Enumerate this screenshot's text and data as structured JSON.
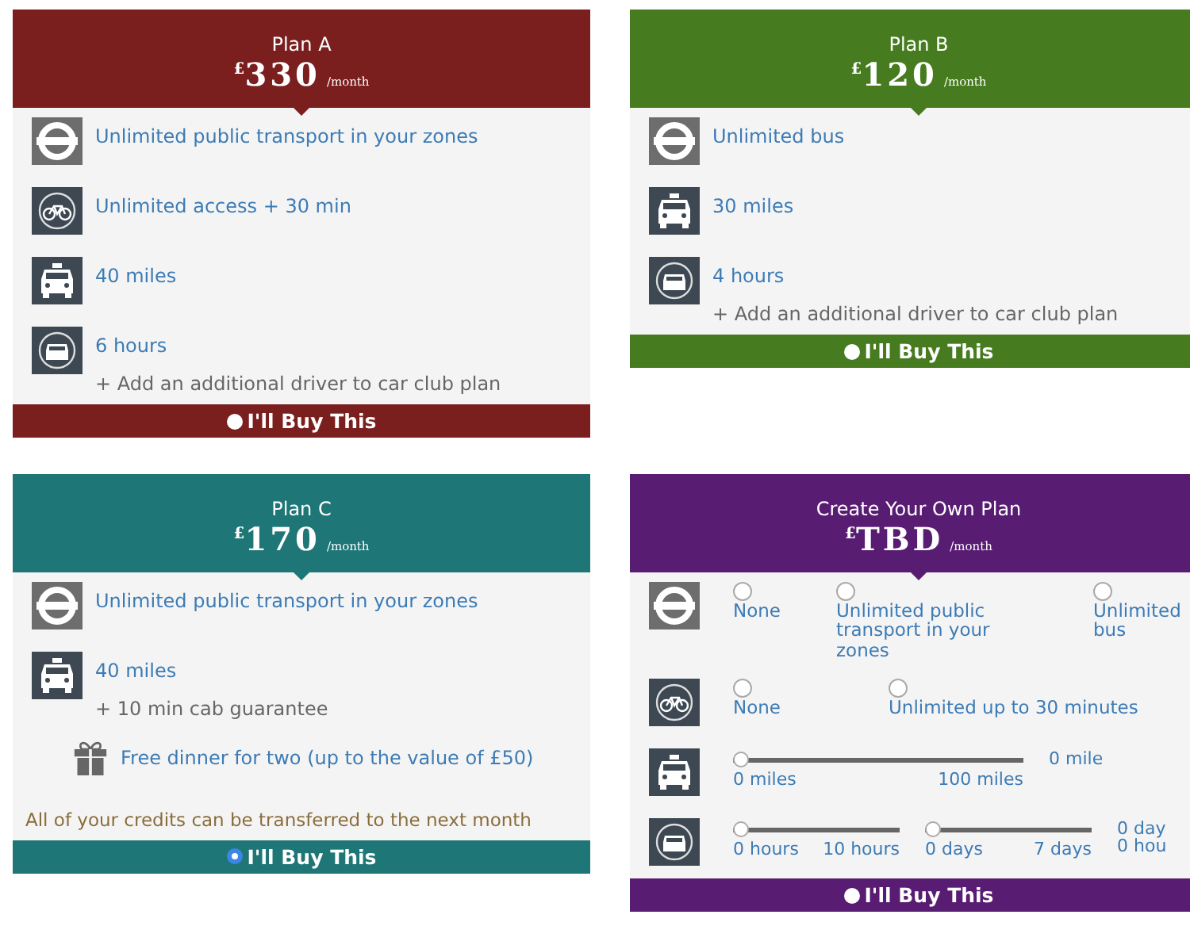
{
  "plans": [
    {
      "title": "Plan A",
      "currency": "£",
      "price": "330",
      "period": "/month",
      "color": "#7a1e1e",
      "features": [
        {
          "kind": "transit",
          "text": "Unlimited public transport in your zones"
        },
        {
          "kind": "bike",
          "text": "Unlimited access + 30 min"
        },
        {
          "kind": "taxi",
          "text": "40 miles"
        },
        {
          "kind": "carclub",
          "text": "6 hours",
          "note": "+ Add an additional driver to car club plan"
        }
      ],
      "buy": {
        "label": "I'll Buy This",
        "selected": false
      }
    },
    {
      "title": "Plan B",
      "currency": "£",
      "price": "120",
      "period": "/month",
      "color": "#467c1f",
      "features": [
        {
          "kind": "transit",
          "text": "Unlimited bus"
        },
        {
          "kind": "taxi",
          "text": "30 miles"
        },
        {
          "kind": "carclub",
          "text": "4 hours",
          "note": "+ Add an additional driver to car club plan"
        }
      ],
      "buy": {
        "label": "I'll Buy This",
        "selected": false
      }
    },
    {
      "title": "Plan C",
      "currency": "£",
      "price": "170",
      "period": "/month",
      "color": "#1f7676",
      "features": [
        {
          "kind": "transit",
          "text": "Unlimited public transport in your zones"
        },
        {
          "kind": "taxi",
          "text": "40 miles",
          "note": "+ 10 min cab guarantee"
        },
        {
          "kind": "gift",
          "text": "Free dinner for two (up to the value of £50)"
        }
      ],
      "footnote": "All of your credits can be transferred to the next month",
      "buy": {
        "label": "I'll Buy This",
        "selected": true
      }
    },
    {
      "title": "Create Your Own Plan",
      "currency": "£",
      "price": "TBD",
      "period": "/month",
      "color": "#581c72",
      "features": [
        {
          "kind": "transit",
          "options": [
            {
              "label": "None",
              "selected": false
            },
            {
              "label": "Unlimited public transport in your zones",
              "selected": false
            },
            {
              "label": "Unlimited bus",
              "selected": false
            }
          ]
        },
        {
          "kind": "bike",
          "options": [
            {
              "label": "None",
              "selected": false
            },
            {
              "label": "Unlimited up to 30 minutes",
              "selected": false
            }
          ]
        },
        {
          "kind": "taxi",
          "sliders": [
            {
              "min": "0 miles",
              "max": "100 miles",
              "level": 0
            }
          ],
          "readings": [
            "0 mile"
          ]
        },
        {
          "kind": "carclub",
          "sliders": [
            {
              "min": "0 hours",
              "max": "10 hours",
              "level": 0
            },
            {
              "min": "0 days",
              "max": "7 days",
              "level": 0
            }
          ],
          "readings": [
            "0 day",
            "0 hou"
          ]
        }
      ],
      "buy": {
        "label": "I'll Buy This",
        "selected": false
      }
    }
  ]
}
